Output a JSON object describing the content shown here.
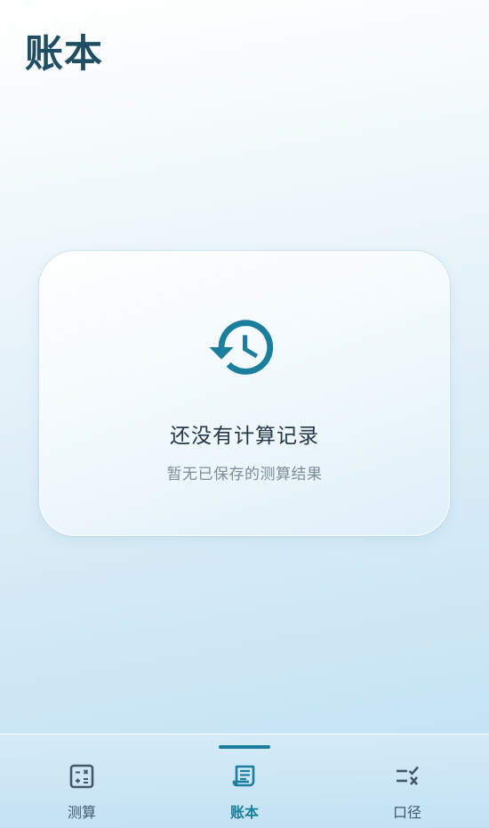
{
  "header": {
    "title": "账本"
  },
  "empty_state": {
    "icon": "history-icon",
    "title": "还没有计算记录",
    "subtitle": "暂无已保存的测算结果"
  },
  "tabs": [
    {
      "label": "测算",
      "icon": "calculator-icon",
      "active": false
    },
    {
      "label": "账本",
      "icon": "ledger-icon",
      "active": true
    },
    {
      "label": "口径",
      "icon": "checklist-icon",
      "active": false
    }
  ],
  "colors": {
    "accent": "#1a7e9c",
    "title": "#1f4e64",
    "icon_inactive": "#41596a"
  }
}
